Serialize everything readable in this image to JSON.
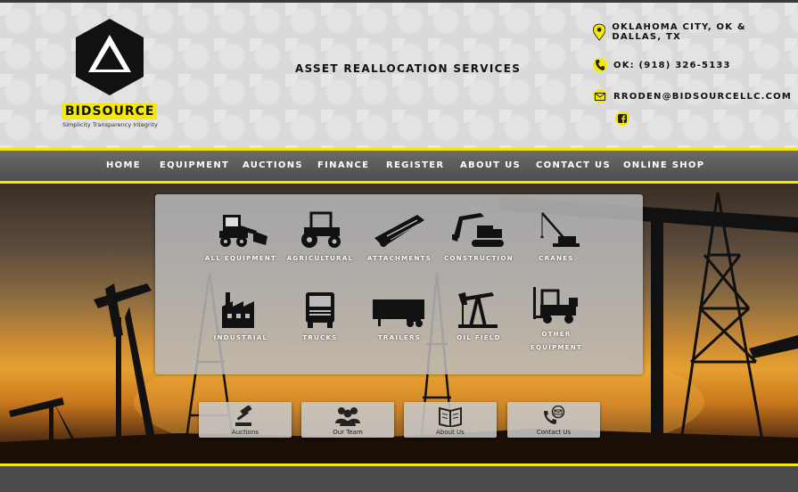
{
  "brand": {
    "name": "BIDSOURCE",
    "tagline": "Simplicity Transparency Integrity"
  },
  "header": {
    "service": "ASSET REALLOCATION SERVICES",
    "location": "OKLAHOMA CITY, OK & DALLAS, TX",
    "phone": "OK: (918) 326-5133",
    "email": "RRODEN@BIDSOURCELLC.COM",
    "accent": "#f4e900"
  },
  "nav": {
    "items": [
      {
        "label": "HOME"
      },
      {
        "label": "EQUIPMENT"
      },
      {
        "label": "AUCTIONS"
      },
      {
        "label": "FINANCE"
      },
      {
        "label": "REGISTER"
      },
      {
        "label": "ABOUT US"
      },
      {
        "label": "CONTACT US"
      },
      {
        "label": "ONLINE SHOP"
      }
    ]
  },
  "categories": [
    {
      "label": "ALL EQUIPMENT",
      "icon": "skid-steer-icon"
    },
    {
      "label": "AGRICULTURAL",
      "icon": "tractor-icon"
    },
    {
      "label": "ATTACHMENTS",
      "icon": "header-attachment-icon"
    },
    {
      "label": "CONSTRUCTION",
      "icon": "excavator-icon"
    },
    {
      "label": "CRANES",
      "icon": "crane-icon"
    },
    {
      "label": "INDUSTRIAL",
      "icon": "factory-icon"
    },
    {
      "label": "TRUCKS",
      "icon": "truck-icon"
    },
    {
      "label": "TRAILERS",
      "icon": "trailer-icon"
    },
    {
      "label": "OIL FIELD",
      "icon": "pumpjack-icon"
    },
    {
      "label": "OTHER EQUIPMENT",
      "label_line1": "OTHER",
      "label_line2": "EQUIPMENT",
      "icon": "forklift-icon"
    }
  ],
  "quick_links": [
    {
      "label": "Auctions",
      "icon": "gavel-icon"
    },
    {
      "label": "Our Team",
      "icon": "team-icon"
    },
    {
      "label": "About Us",
      "icon": "book-icon"
    },
    {
      "label": "Contact Us",
      "icon": "phone-mail-icon"
    }
  ]
}
